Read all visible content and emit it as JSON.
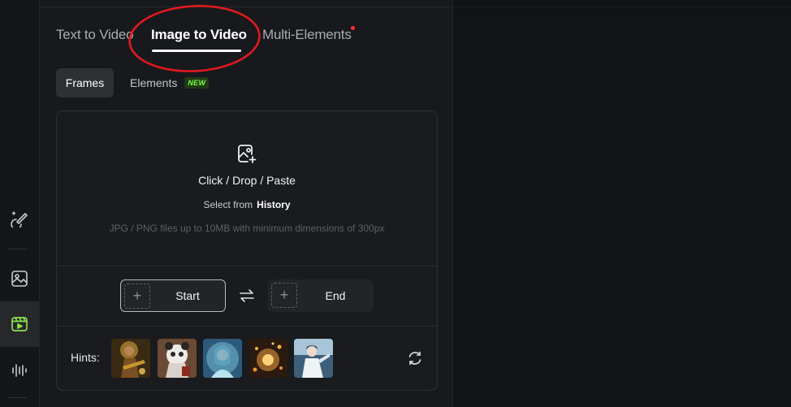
{
  "tabs": [
    {
      "label": "Text to Video",
      "active": false
    },
    {
      "label": "Image to Video",
      "active": true
    },
    {
      "label": "Multi-Elements",
      "active": false,
      "notification_dot": true
    }
  ],
  "subtabs": {
    "frames": "Frames",
    "elements": "Elements",
    "elements_badge": "NEW"
  },
  "upload": {
    "icon": "add-image-icon",
    "title": "Click / Drop / Paste",
    "select_prefix": "Select from",
    "select_link": "History",
    "note": "JPG / PNG files up to 10MB with minimum dimensions of 300px"
  },
  "frames": {
    "start_label": "Start",
    "end_label": "End",
    "swap_icon": "swap-arrows-icon"
  },
  "hints": {
    "label": "Hints:",
    "thumbnails": [
      {
        "name": "hint-thumb-1",
        "palette": [
          "#3a2a14",
          "#c9952e"
        ]
      },
      {
        "name": "hint-thumb-2",
        "palette": [
          "#6a4a34",
          "#e8e4df"
        ]
      },
      {
        "name": "hint-thumb-3",
        "palette": [
          "#2d5a7a",
          "#9bd0e6"
        ]
      },
      {
        "name": "hint-thumb-4",
        "palette": [
          "#2a1a10",
          "#f0a040"
        ]
      },
      {
        "name": "hint-thumb-5",
        "palette": [
          "#3d5f7a",
          "#dfe8ee"
        ]
      }
    ],
    "refresh_icon": "refresh-icon"
  },
  "sidebar_icons": [
    "magic-wand-icon",
    "image-icon",
    "video-icon",
    "audio-wave-icon"
  ],
  "colors": {
    "accent_green": "#7dff4a",
    "annotation_red": "#e0191f",
    "notification_red": "#ff2d2d",
    "active_sidebar_icon": "#8ee04a"
  }
}
